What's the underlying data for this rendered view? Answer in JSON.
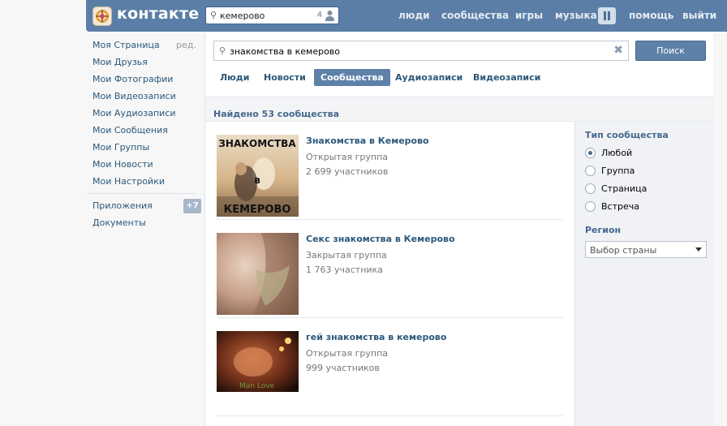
{
  "header": {
    "brand": "контакте",
    "search_value": "кемерово",
    "search_count": "4",
    "nav": [
      "люди",
      "сообщества",
      "игры",
      "музыка",
      "помощь",
      "выйти"
    ],
    "accent": "#5b7ea6"
  },
  "sidebar": {
    "edit_label": "ред.",
    "items": [
      {
        "label": "Моя Страница"
      },
      {
        "label": "Мои Друзья"
      },
      {
        "label": "Мои Фотографии"
      },
      {
        "label": "Мои Видеозаписи"
      },
      {
        "label": "Мои Аудиозаписи"
      },
      {
        "label": "Мои Сообщения"
      },
      {
        "label": "Мои Группы"
      },
      {
        "label": "Мои Новости"
      },
      {
        "label": "Мои Настройки"
      }
    ],
    "extra": [
      {
        "label": "Приложения",
        "badge": "+7"
      },
      {
        "label": "Документы"
      }
    ]
  },
  "search": {
    "query": "знакомства в кемерово",
    "button_label": "Поиск"
  },
  "tabs": [
    {
      "label": "Люди",
      "active": false
    },
    {
      "label": "Новости",
      "active": false
    },
    {
      "label": "Сообщества",
      "active": true
    },
    {
      "label": "Аудиозаписи",
      "active": false
    },
    {
      "label": "Видеозаписи",
      "active": false
    }
  ],
  "results_header": "Найдено 53 сообщества",
  "results": [
    {
      "title": "Знакомства в Кемерово",
      "type": "Открытая группа",
      "members": "2 699 участников",
      "thumb_text_top": "ЗНАКОМСТВА",
      "thumb_text_mid": "в",
      "thumb_text_bottom": "КЕМЕРОВО"
    },
    {
      "title": "Секс знакомства в Кемерово",
      "type": "Закрытая группа",
      "members": "1 763 участника"
    },
    {
      "title": "гей знакомства в кемерово",
      "type": "Открытая группа",
      "members": "999 участников",
      "thumb_text_bottom": "Man Love"
    }
  ],
  "filter": {
    "type_heading": "Тип сообщества",
    "types": [
      {
        "label": "Любой",
        "selected": true
      },
      {
        "label": "Группа",
        "selected": false
      },
      {
        "label": "Страница",
        "selected": false
      },
      {
        "label": "Встреча",
        "selected": false
      }
    ],
    "region_heading": "Регион",
    "region_value": "Выбор страны"
  }
}
